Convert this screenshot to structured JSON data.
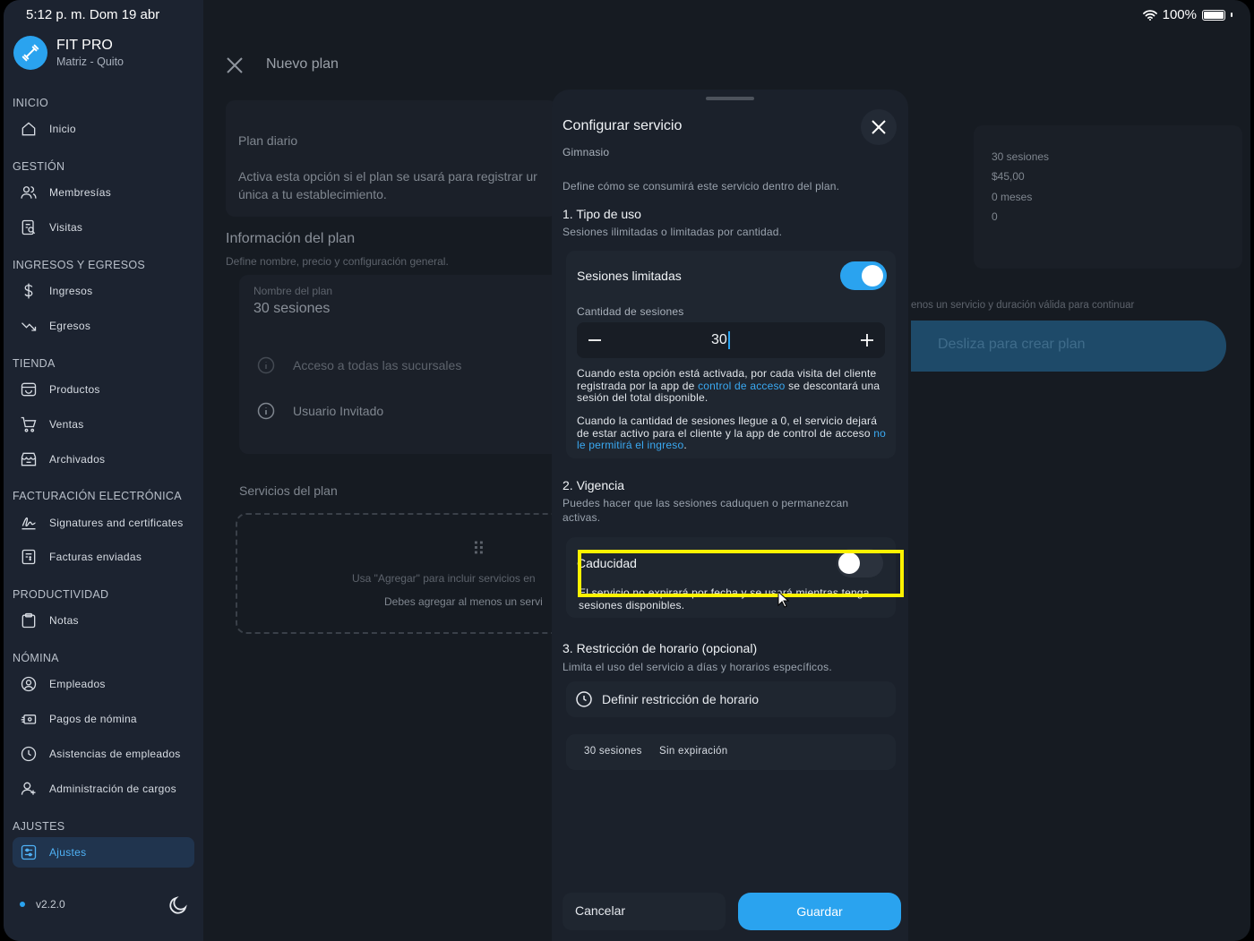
{
  "status_bar": {
    "time": "5:12 p. m.   Dom 19 abr",
    "battery": "100%"
  },
  "brand": {
    "name": "FIT PRO",
    "sub": "Matriz - Quito"
  },
  "sidebar": {
    "sections": {
      "inicio": "INICIO",
      "gestion": "GESTIÓN",
      "ingresos": "INGRESOS Y EGRESOS",
      "tienda": "TIENDA",
      "facturacion": "FACTURACIÓN ELECTRÓNICA",
      "productividad": "PRODUCTIVIDAD",
      "nomina": "NÓMINA",
      "ajustes": "AJUSTES"
    },
    "items": {
      "inicio": "Inicio",
      "membresias": "Membresías",
      "visitas": "Visitas",
      "ingresos": "Ingresos",
      "egresos": "Egresos",
      "productos": "Productos",
      "ventas": "Ventas",
      "archivados": "Archivados",
      "signatures": "Signatures and certificates",
      "facturas": "Facturas enviadas",
      "notas": "Notas",
      "empleados": "Empleados",
      "pagos": "Pagos de nómina",
      "asistencias": "Asistencias de empleados",
      "cargos": "Administración de cargos",
      "ajustes": "Ajustes"
    },
    "version": "v2.2.0"
  },
  "background": {
    "title": "Nuevo plan",
    "plan_diario": "Plan diario",
    "plan_diario_desc_1": "Activa esta opción si el plan se usará para registrar ur",
    "plan_diario_desc_2": "única a tu establecimiento.",
    "info_title": "Información del plan",
    "info_sub": "Define nombre, precio y configuración general.",
    "name_label": "Nombre del plan",
    "name_value": "30 sesiones",
    "acceso": "Acceso a todas las sucursales",
    "invitado": "Usuario Invitado",
    "servicios_title": "Servicios del plan",
    "servicios_hint": "Usa \"Agregar\" para incluir servicios en",
    "servicios_warn": "Debes agregar al menos un servi",
    "summary": [
      "30 sesiones",
      "$45,00",
      "0 meses",
      "0"
    ],
    "continue_hint": "enos un servicio y duración válida para continuar",
    "slide_label": "Desliza para crear plan"
  },
  "modal": {
    "title": "Configurar servicio",
    "subtitle": "Gimnasio",
    "description": "Define cómo se consumirá este servicio dentro del plan.",
    "section1_title": "1. Tipo de uso",
    "section1_sub": "Sesiones ilimitadas o limitadas por cantidad.",
    "limited_label": "Sesiones limitadas",
    "limited_on": true,
    "qty_label": "Cantidad de sesiones",
    "qty_value": "30",
    "info1_a": "Cuando esta opción está activada, por cada visita del cliente registrada por la app de ",
    "info1_link": "control de acceso",
    "info1_b": " se descontará una sesión del total disponible.",
    "info2_a": "Cuando la cantidad de sesiones llegue a 0, el servicio dejará de estar activo para el cliente y la app de control de acceso ",
    "info2_link": "no le permitirá el ingreso",
    "info2_b": ".",
    "section2_title": "2. Vigencia",
    "section2_sub": "Puedes hacer que las sesiones caduquen o permanezcan activas.",
    "caducidad_label": "Caducidad",
    "caducidad_on": false,
    "caducidad_info": "El servicio no expirará por fecha y se usará mientras tenga sesiones disponibles.",
    "section3_title": "3. Restricción de horario (opcional)",
    "section3_sub": "Limita el uso del servicio a días y horarios específicos.",
    "restriction_btn": "Definir restricción de horario",
    "summary_chips": [
      "30 sesiones",
      "Sin expiración"
    ],
    "cancel": "Cancelar",
    "save": "Guardar"
  },
  "colors": {
    "accent": "#2aa3ef",
    "highlight": "#fff200",
    "bg": "#161b22"
  }
}
